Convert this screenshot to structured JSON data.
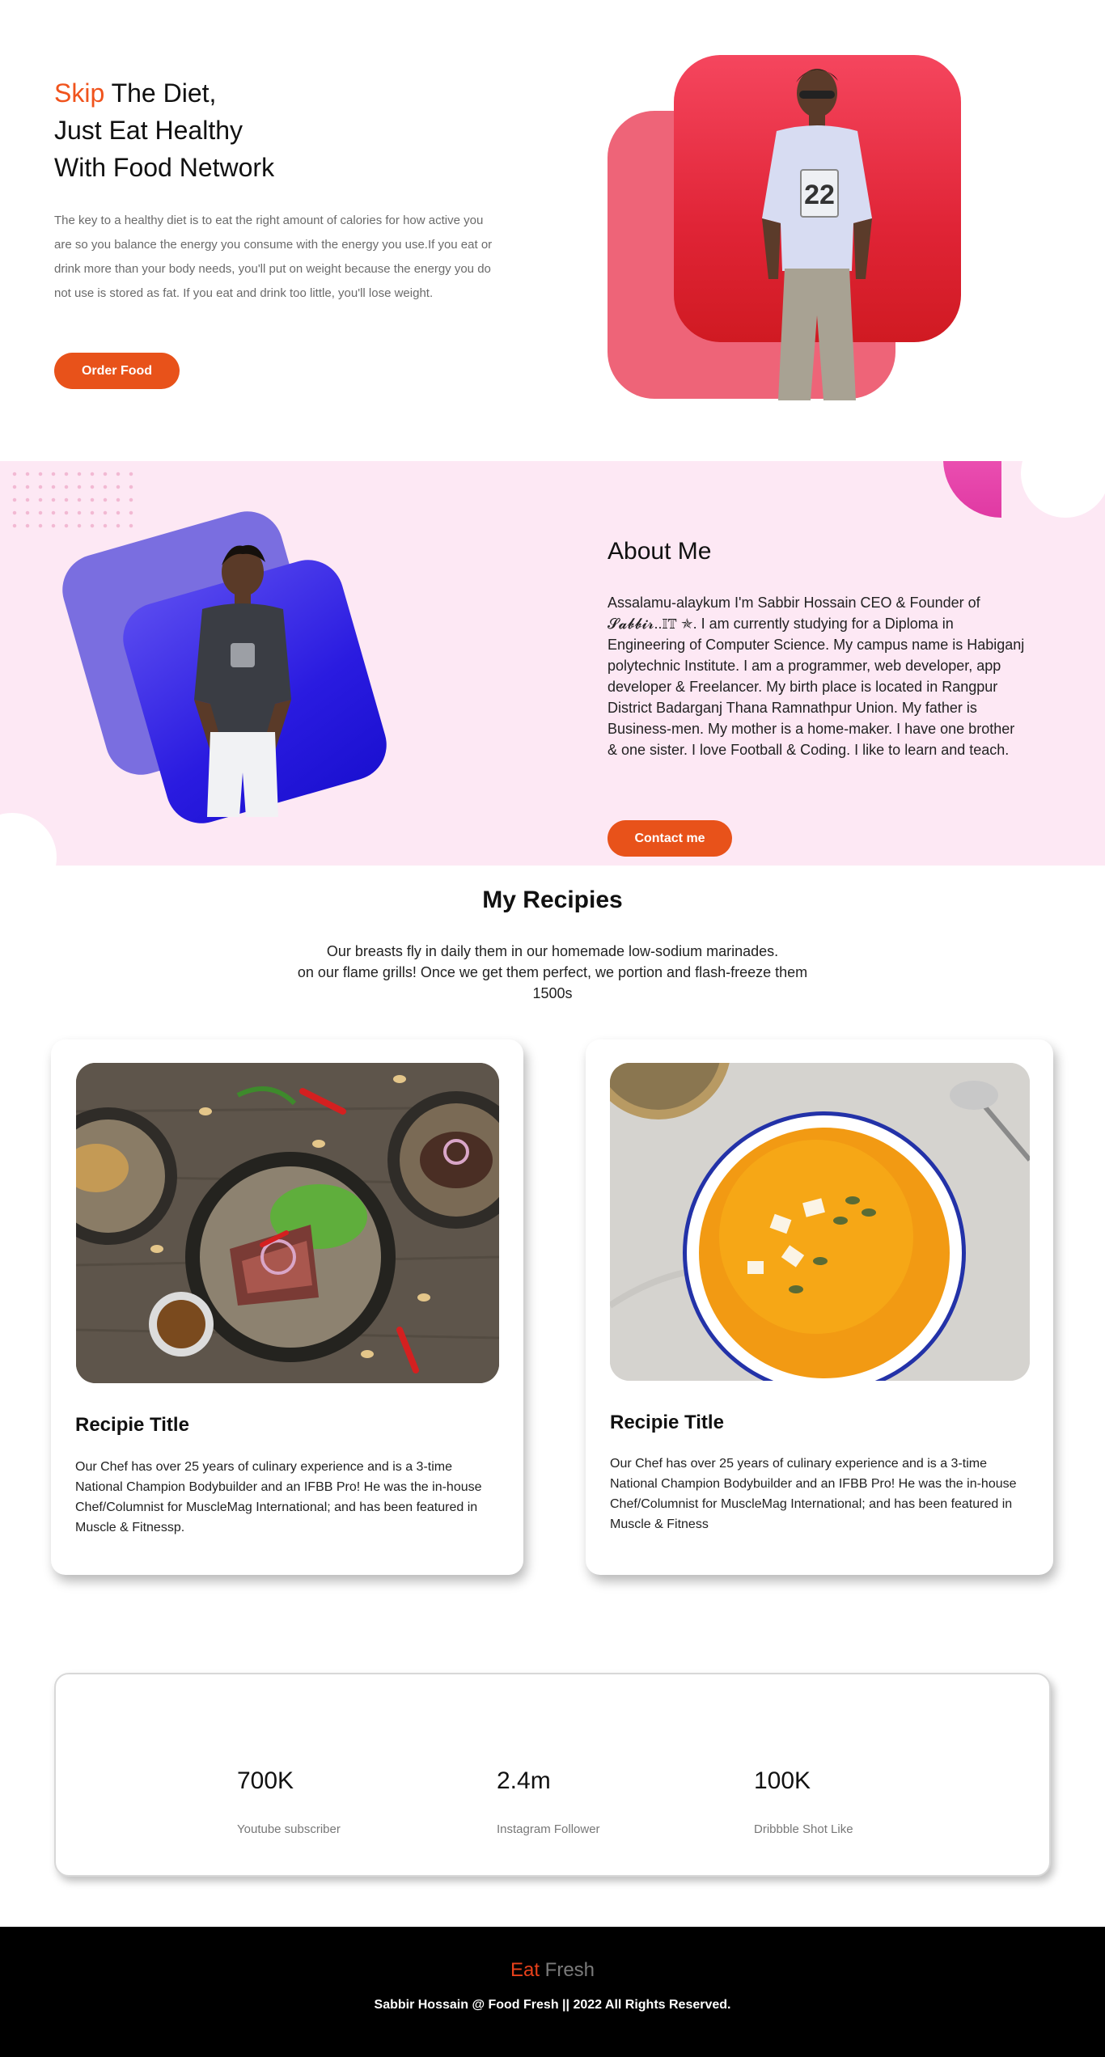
{
  "hero": {
    "title_accent": "Skip",
    "title_line1_rest": " The Diet,",
    "title_line2": "Just Eat Healthy",
    "title_line3": "With Food Network",
    "text": "The key to a healthy diet is to eat the right amount of calories for how active you are so you balance the energy you consume with the energy you use.If you eat or drink more than your body needs, you'll put on weight because the energy you do not use is stored as fat. If you eat and drink too little, you'll lose weight.",
    "button_label": "Order Food"
  },
  "about": {
    "title": "About Me",
    "text": "Assalamu-alaykum I'm Sabbir Hossain CEO & Founder of 𝓢𝓪𝓫𝓫𝓲𝓻..𝕀𝕋 ✯. I am currently studying for a Diploma in Engineering of Computer Science. My campus name is Habiganj polytechnic Institute. I am a programmer, web developer, app developer & Freelancer. My birth place is located in Rangpur District Badarganj Thana Ramnathpur Union. My father is Business-men. My mother is a home-maker. I have one brother & one sister. I love Football & Coding. I like to learn and teach.",
    "button_label": "Contact me"
  },
  "recipes": {
    "title": "My Recipies",
    "desc_line1": "Our breasts fly in daily them in our homemade low-sodium marinades.",
    "desc_line2": "on our flame grills! Once we get them perfect, we portion and flash-freeze them",
    "desc_line3": "1500s",
    "cards": [
      {
        "title": "Recipie Title",
        "text": "Our Chef has over 25 years of culinary experience and is a 3-time National Champion Bodybuilder and an IFBB Pro! He was the in-house Chef/Columnist for MuscleMag International; and has been featured in Muscle & Fitnessp."
      },
      {
        "title": "Recipie Title",
        "text": "Our Chef has over 25 years of culinary experience and is a 3-time National Champion Bodybuilder and an IFBB Pro! He was the in-house Chef/Columnist for MuscleMag International; and has been featured in Muscle & Fitness"
      }
    ]
  },
  "stats": [
    {
      "value": "700K",
      "label": "Youtube subscriber"
    },
    {
      "value": "2.4m",
      "label": "Instagram Follower"
    },
    {
      "value": "100K",
      "label": "Dribbble Shot Like"
    }
  ],
  "footer": {
    "brand_part1": "Eat",
    "brand_part2": " Fresh",
    "copyright": "Sabbir Hossain @ Food Fresh || 2022 All Rights Reserved."
  },
  "colors": {
    "accent": "#e8521a",
    "about_bg": "#fde8f4",
    "footer_bg": "#000000"
  }
}
